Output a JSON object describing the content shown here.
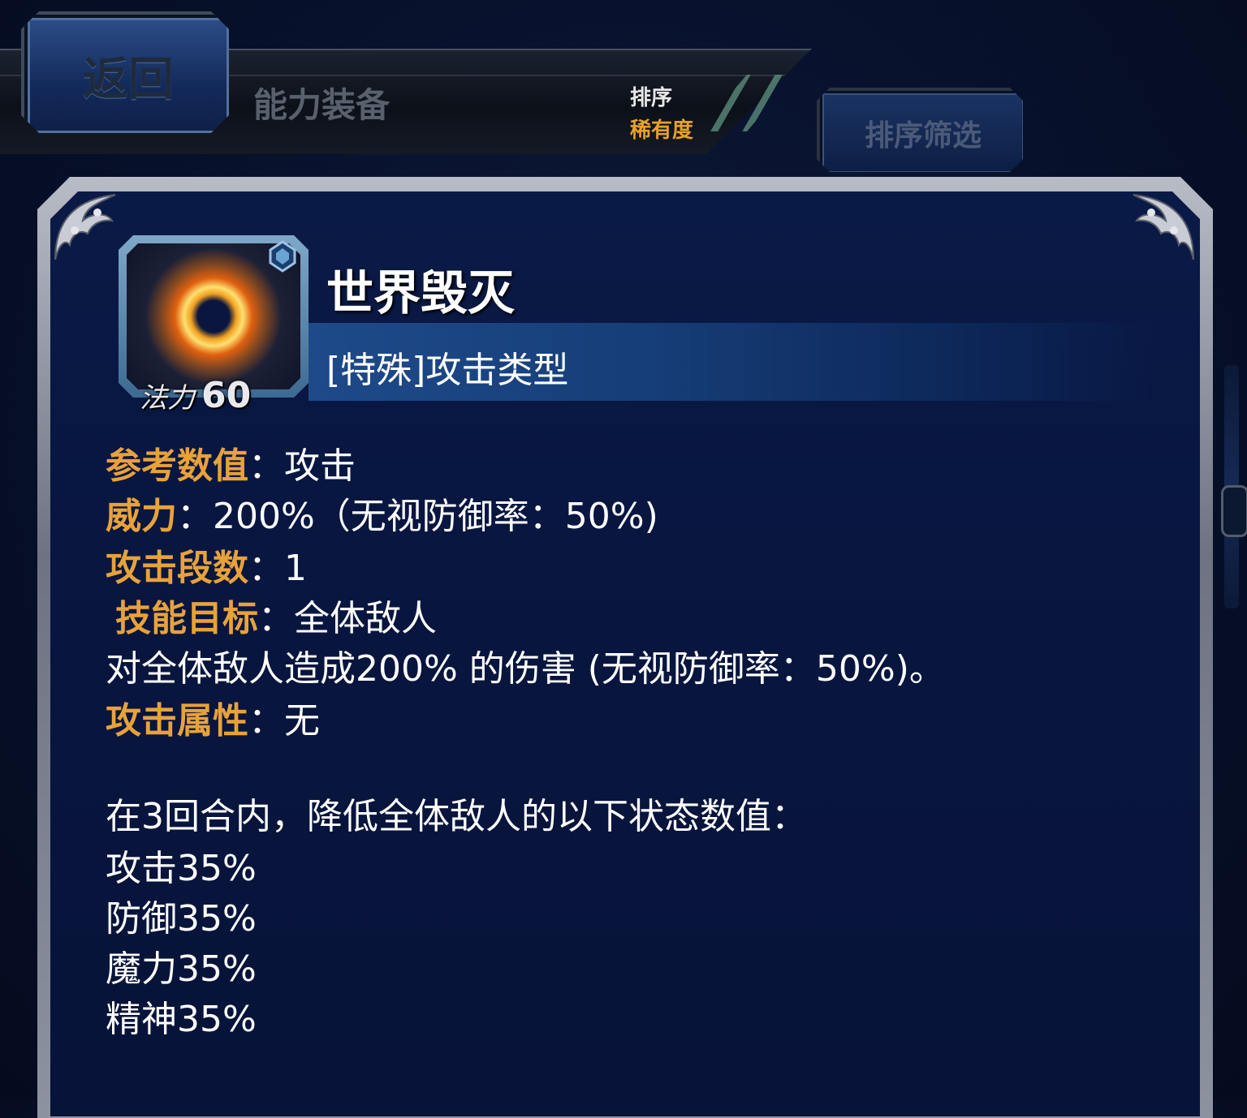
{
  "header": {
    "back_label": "返回",
    "title": "能力装备",
    "sort_label": "排序",
    "sort_value": "稀有度",
    "filter_label": "排序筛选"
  },
  "skill": {
    "name": "世界毁灭",
    "type": "[特殊]攻击类型",
    "mp_label": "法力",
    "mp_value": "60",
    "icon": "explosion-icon"
  },
  "details": {
    "ref_key": "参考数值",
    "ref_val": "：攻击",
    "power_key": "威力",
    "power_val": "：200%（无视防御率：50%)",
    "hits_key": "攻击段数",
    "hits_val": "：1",
    "target_key": "技能目标",
    "target_val": "：全体敌人",
    "effect_line": "对全体敌人造成200% 的伤害 (无视防御率：50%)。",
    "element_key": "攻击属性",
    "element_val": "：无",
    "debuff_intro": "在3回合内，降低全体敌人的以下状态数值：",
    "debuffs": [
      "攻击35%",
      "防御35%",
      "魔力35%",
      "精神35%"
    ]
  },
  "colors": {
    "key_text": "#e8a23a",
    "panel_bg": "#0a1a46",
    "sort_value": "#e6a02c"
  }
}
